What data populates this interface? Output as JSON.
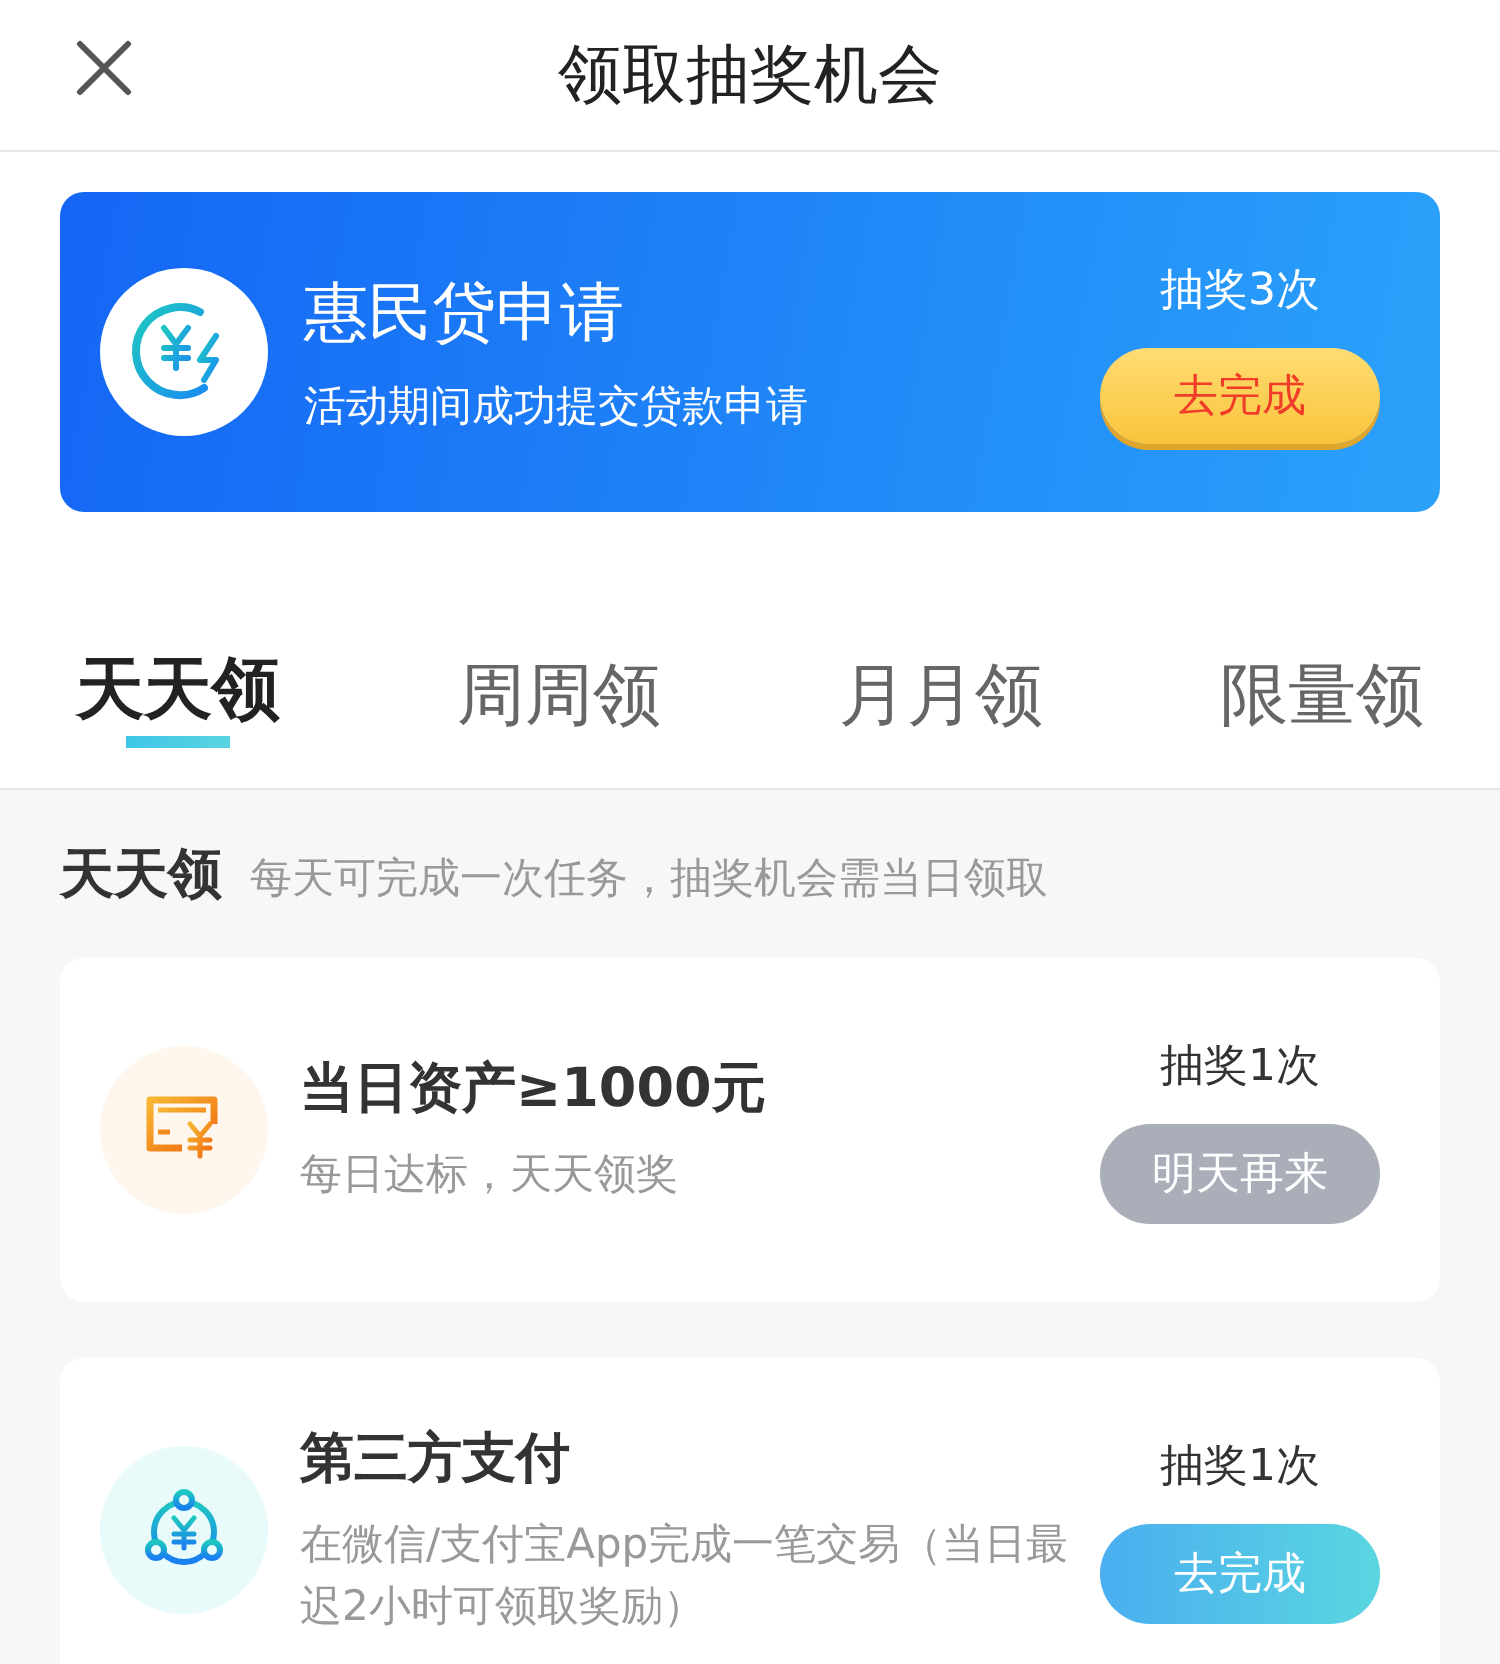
{
  "header": {
    "title": "领取抽奖机会"
  },
  "banner": {
    "title": "惠民贷申请",
    "subtitle": "活动期间成功提交贷款申请",
    "reward": "抽奖3次",
    "button": "去完成"
  },
  "tabs": [
    {
      "label": "天天领",
      "selected": true
    },
    {
      "label": "周周领",
      "selected": false
    },
    {
      "label": "月月领",
      "selected": false
    },
    {
      "label": "限量领",
      "selected": false
    }
  ],
  "section": {
    "title": "天天领",
    "note": "每天可完成一次任务，抽奖机会需当日领取"
  },
  "tasks": [
    {
      "kind": "asset",
      "title": "当日资产≥1000元",
      "description": "每日达标，天天领奖",
      "reward": "抽奖1次",
      "button": "明天再来",
      "disabled": true
    },
    {
      "kind": "payment",
      "title": "第三方支付",
      "description": "在微信/支付宝App完成一笔交易（当日最迟2小时可领取奖励）",
      "reward": "抽奖1次",
      "button": "去完成",
      "disabled": false
    }
  ]
}
